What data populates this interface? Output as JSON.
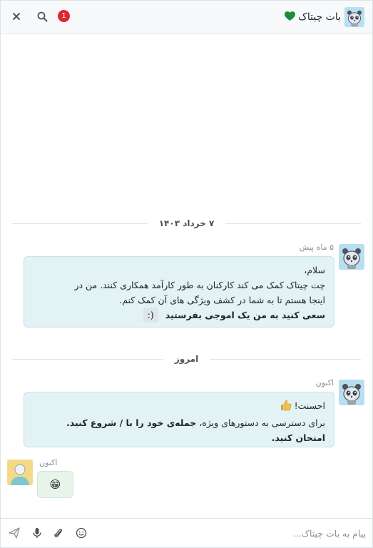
{
  "header": {
    "title": "بات چیتاک",
    "notification_count": "1",
    "heart_color": "#1e8a3a"
  },
  "thread": {
    "dividers": [
      {
        "label": "۷ خرداد ۱۴۰۳"
      },
      {
        "label": "امروز"
      }
    ],
    "messages": [
      {
        "author": "bot",
        "time": "۵ ماه پیش",
        "line1": "سلام،",
        "line2": "چت چیتاک کمک می کند کارکنان به طور کارآمد همکاری کنند. من در",
        "line3": "اینجا هستم تا به شما در کشف ویژگی های آن کمک کنم.",
        "line4": "سعی کنید به من یک اموجی بفرستید",
        "emoji_hint": ":)"
      },
      {
        "author": "bot",
        "time": "اکنون",
        "line1": "احسنت!",
        "line2_pre": "برای دسترسی به دستورهای ویژه، ",
        "line2_bold": "جمله‌ی خود را با / شروع کنید.",
        "line3": "امتحان کنید."
      },
      {
        "author": "user",
        "time": "اکنون",
        "content": "😁"
      }
    ]
  },
  "composer": {
    "placeholder": "پیام به بات چیتاک..."
  },
  "icons": {
    "close": "close-icon",
    "search": "search-icon",
    "heart": "heart-icon",
    "send": "send-icon",
    "mic": "microphone-icon",
    "attach": "paperclip-icon",
    "emoji": "emoji-icon",
    "thumbs_up": "thumbs-up-icon"
  }
}
